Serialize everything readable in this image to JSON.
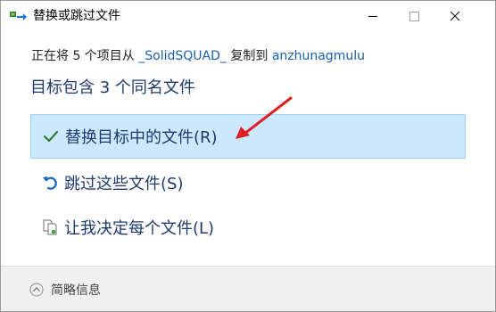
{
  "window": {
    "title": "替换或跳过文件"
  },
  "copy": {
    "prefix": "正在将 5 个项目从",
    "source": "_SolidSQUAD_",
    "middle": "复制到",
    "destination": "anzhunagmulu"
  },
  "headline": "目标包含 3 个同名文件",
  "options": [
    {
      "label": "替换目标中的文件(R)",
      "icon": "check-icon",
      "selected": true
    },
    {
      "label": "跳过这些文件(S)",
      "icon": "undo-icon",
      "selected": false
    },
    {
      "label": "让我决定每个文件(L)",
      "icon": "compare-files-icon",
      "selected": false
    }
  ],
  "footer": {
    "details_label": "简略信息"
  },
  "colors": {
    "selected_bg": "#cce8ff",
    "selected_border": "#99d1ff",
    "link": "#1a5fb4",
    "heading": "#1e3a6e",
    "annotation_arrow": "#e02020"
  }
}
